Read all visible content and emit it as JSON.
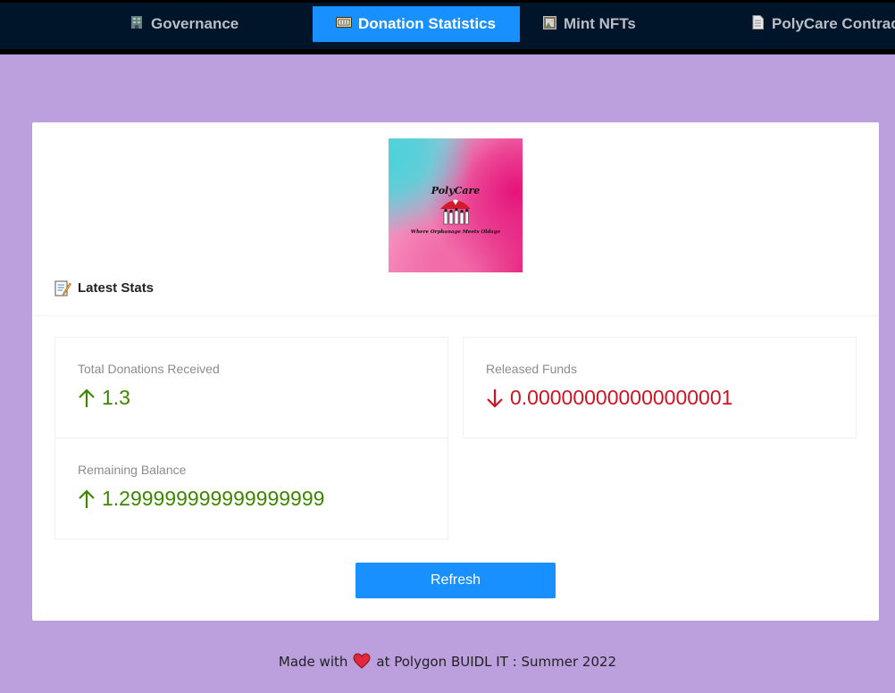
{
  "nav": {
    "tabs": [
      {
        "label": "Governance",
        "icon": "building-icon"
      },
      {
        "label": "Donation Statistics",
        "icon": "ticket-icon"
      },
      {
        "label": "Mint NFTs",
        "icon": "framed-picture-icon"
      },
      {
        "label": "PolyCare Contract",
        "icon": "document-icon"
      }
    ],
    "active_tab": "Donation Statistics"
  },
  "logo": {
    "title": "PolyCare",
    "tagline": "Where Orphanage Meets Oldage"
  },
  "card": {
    "heading": "Latest Stats",
    "heading_icon": "memo-icon"
  },
  "stats": [
    {
      "label": "Total Donations Received",
      "value": "1.3",
      "trend": "up"
    },
    {
      "label": "Released Funds",
      "value": "0.000000000000000001",
      "trend": "down"
    },
    {
      "label": "Remaining Balance",
      "value": "1.299999999999999999",
      "trend": "up"
    }
  ],
  "colors": {
    "up": "#3f8600",
    "down": "#cf1322",
    "primary": "#1890ff",
    "nav_bg": "#001529",
    "page_bg": "#bc9fdd"
  },
  "refresh_button": {
    "label": "Refresh"
  },
  "footer": {
    "before": "Made with",
    "after": "at Polygon BUIDL IT : Summer 2022",
    "icon": "heart-icon"
  }
}
